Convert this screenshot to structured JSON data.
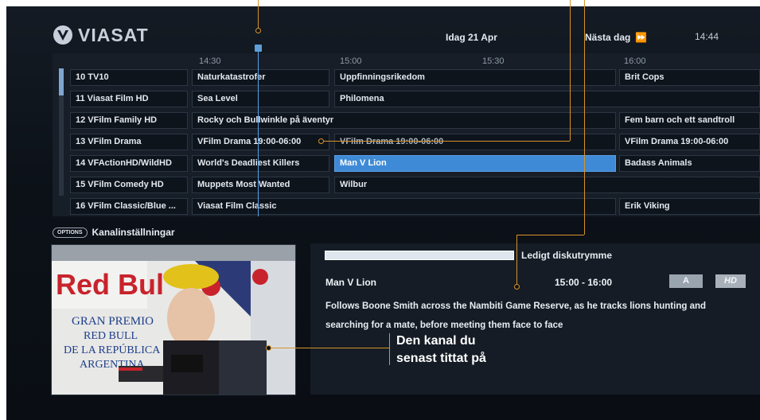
{
  "header": {
    "brand": "VIASAT",
    "date": "Idag 21 Apr",
    "next_day_label": "Nästa dag",
    "next_day_icon": "fast-forward-icon",
    "clock": "14:44"
  },
  "guide": {
    "time_labels": [
      "14:30",
      "15:00",
      "15:30",
      "16:00"
    ],
    "rows": [
      {
        "channel": "10 TV10",
        "programs": [
          "Naturkatastrofer",
          "Uppfinningsrikedom",
          "Brit Cops"
        ]
      },
      {
        "channel": "11 Viasat Film HD",
        "programs": [
          "Sea Level",
          "Philomena"
        ]
      },
      {
        "channel": "12 VFilm Family HD",
        "programs": [
          "Rocky och Bullwinkle på äventyr",
          "Fem barn och ett sandtroll"
        ]
      },
      {
        "channel": "13 VFilm Drama",
        "programs": [
          "VFilm Drama 19:00-06:00",
          "VFilm Drama 19:00-06:00",
          "VFilm Drama 19:00-06:00"
        ]
      },
      {
        "channel": "14 VFActionHD/WildHD",
        "programs": [
          "World's Deadliest Killers",
          "Man V Lion",
          "Badass Animals"
        ]
      },
      {
        "channel": "15 VFilm Comedy HD",
        "programs": [
          "Muppets Most Wanted",
          "Wilbur"
        ]
      },
      {
        "channel": "16 VFilm Classic/Blue ...",
        "programs": [
          "Viasat Film Classic",
          "Erik Viking"
        ]
      }
    ]
  },
  "options": {
    "button_label": "OPTIONS",
    "label": "Kanalinställningar"
  },
  "preview": {
    "alt_name": "last-watched-channel-video"
  },
  "info": {
    "disk_label": "Ledigt diskutrymme",
    "title": "Man V Lion",
    "time": "15:00 - 16:00",
    "badge_rating": "A",
    "badge_hd": "HD",
    "description": "Follows Boone Smith across the Nambiti Game Reserve, as he tracks lions hunting and searching for a mate, before meeting them face to face"
  },
  "annotation": {
    "line1": "Den kanal du",
    "line2": "senast tittat på"
  },
  "colors": {
    "selected": "#3f8ad6",
    "leader": "#d8922b"
  }
}
